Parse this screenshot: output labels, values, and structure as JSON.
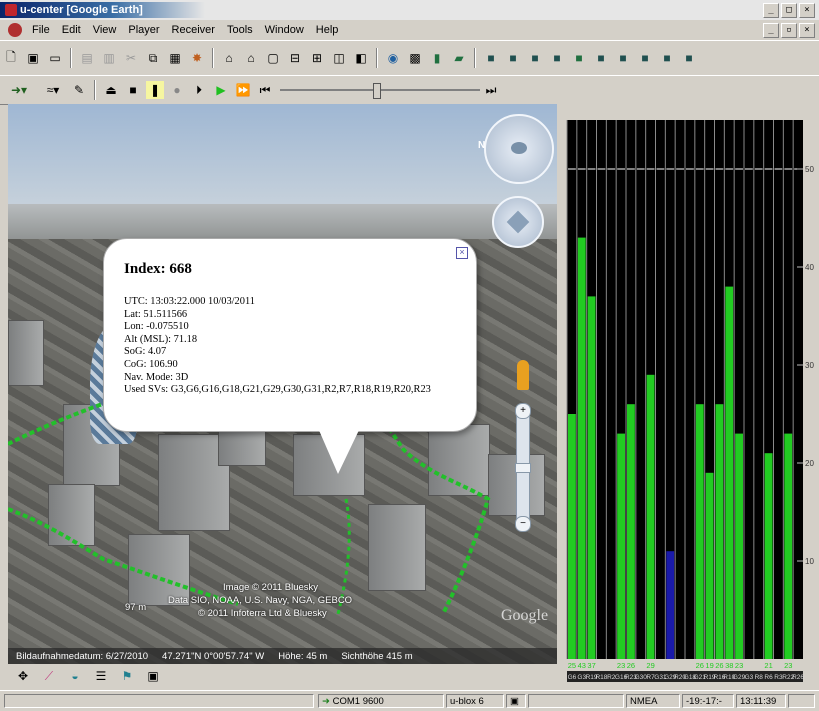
{
  "window": {
    "title": "u-center  [Google Earth]"
  },
  "menu": {
    "items": [
      "File",
      "Edit",
      "View",
      "Player",
      "Receiver",
      "Tools",
      "Window",
      "Help"
    ]
  },
  "player": {
    "slider_position": 0.48
  },
  "map": {
    "popup": {
      "title": "Index: 668",
      "lines": [
        "UTC: 13:03:22.000 10/03/2011",
        "Lat: 51.511566",
        "Lon: -0.075510",
        "Alt (MSL): 71.18",
        "SoG: 4.07",
        "CoG: 106.90",
        "Nav. Mode: 3D",
        "Used SVs: G3,G6,G16,G18,G21,G29,G30,G31,R2,R7,R18,R19,R20,R23"
      ]
    },
    "credits": [
      "Image © 2011 Bluesky",
      "Data SIO, NOAA, U.S. Navy, NGA, GEBCO",
      "© 2011 Infoterra Ltd & Bluesky"
    ],
    "scale_label": "97 m",
    "logo_text": "Google",
    "status": {
      "image_date": "Bildaufnahmedatum: 6/27/2010",
      "coords": "47.271\"N   0°00'57.74\" W",
      "elevation": "Höhe:  45 m",
      "eye_alt": "Sichthöhe    415 m"
    }
  },
  "signal_chart": {
    "y_ticks": [
      "50",
      "40",
      "30",
      "20",
      "10"
    ],
    "ylim": [
      0,
      55
    ],
    "value_labels": [
      "25",
      "43",
      "37",
      "",
      "",
      "23",
      "26",
      "",
      "29",
      "",
      "",
      "",
      "",
      "26",
      "19",
      "26",
      "38",
      "23",
      "",
      "",
      "21",
      "",
      "23",
      ""
    ],
    "sat_labels": [
      "G6",
      "G3",
      "R19",
      "R18",
      "R2",
      "G16",
      "R23",
      "G30",
      "R7",
      "G31",
      "G29",
      "R20",
      "G18",
      "G21",
      "R19",
      "R16",
      "R10",
      "G29",
      "G3",
      "R8",
      "R6",
      "R3",
      "R22",
      "R26"
    ],
    "values": [
      25,
      43,
      37,
      0,
      0,
      23,
      26,
      0,
      29,
      0,
      11,
      0,
      0,
      26,
      19,
      26,
      38,
      23,
      0,
      0,
      21,
      0,
      23,
      0
    ],
    "bar_colors": [
      "green",
      "green",
      "green",
      "green",
      "green",
      "green",
      "green",
      "green",
      "green",
      "green",
      "blue",
      "green",
      "green",
      "green",
      "green",
      "green",
      "green",
      "green",
      "green",
      "green",
      "green",
      "green",
      "green",
      "green"
    ],
    "colors": {
      "used": "#22cc22",
      "tracked": "#1a1aaa",
      "background": "#000000"
    }
  },
  "status_bar": {
    "port": "COM1 9600",
    "receiver": "u-blox 6",
    "protocol": "NMEA",
    "utc": "-19:-17:-",
    "time": "13:11:39"
  }
}
